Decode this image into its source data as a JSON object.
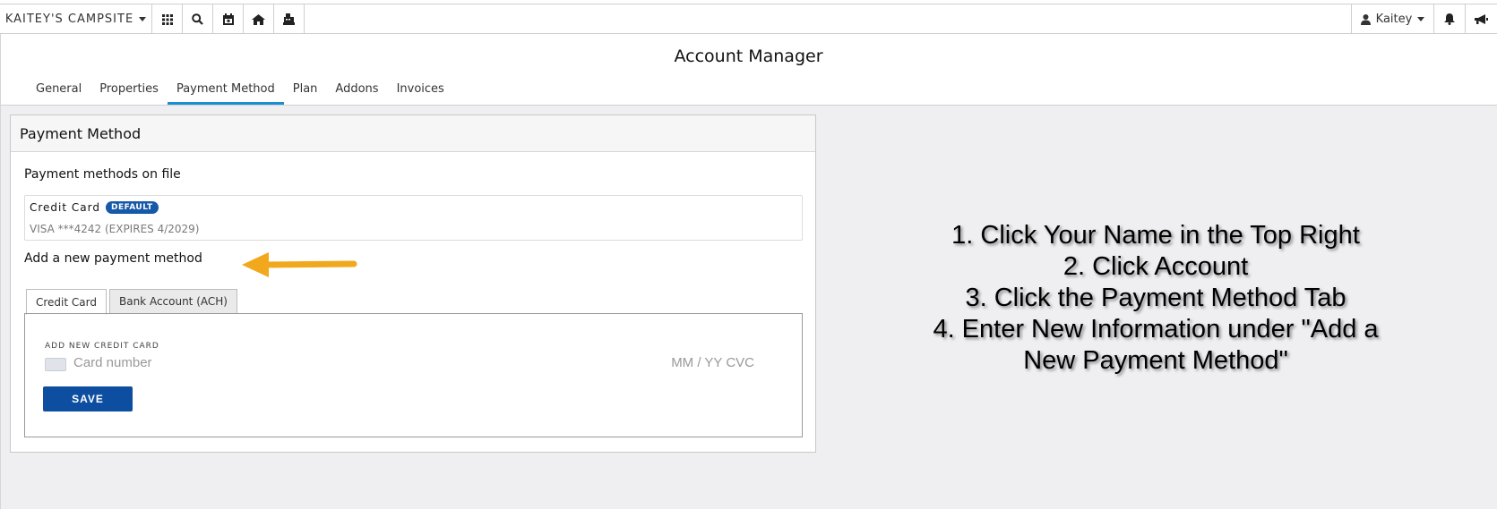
{
  "topbar": {
    "site_name": "KAITEY'S CAMPSITE",
    "icons": [
      "grid-icon",
      "search-icon",
      "calendar-icon",
      "home-icon",
      "register-icon"
    ],
    "user_name": "Kaitey",
    "right_icons": [
      "bell-icon",
      "megaphone-icon"
    ]
  },
  "page": {
    "title": "Account Manager",
    "tabs": [
      "General",
      "Properties",
      "Payment Method",
      "Plan",
      "Addons",
      "Invoices"
    ],
    "active_tab": "Payment Method"
  },
  "card": {
    "header": "Payment Method",
    "on_file_title": "Payment methods on file",
    "method_name": "Credit Card",
    "method_badge": "DEFAULT",
    "method_detail": "VISA ***4242 (EXPIRES 4/2029)",
    "add_title": "Add a new payment method",
    "subtabs": [
      "Credit Card",
      "Bank Account (ACH)"
    ],
    "cc_label": "ADD NEW CREDIT CARD",
    "card_number_placeholder": "Card number",
    "exp_cvc_placeholder": "MM / YY  CVC",
    "save_label": "SAVE"
  },
  "instructions": {
    "line1": "1. Click Your Name in the Top Right",
    "line2": "2. Click Account",
    "line3": "3. Click the Payment Method Tab",
    "line4": "4. Enter New Information under \"Add a",
    "line5": "New Payment Method\""
  },
  "colors": {
    "accent": "#1a8fd0",
    "button": "#0e4ea0",
    "badge": "#1559a8",
    "arrow": "#f2a81d",
    "background": "#efeff1"
  }
}
